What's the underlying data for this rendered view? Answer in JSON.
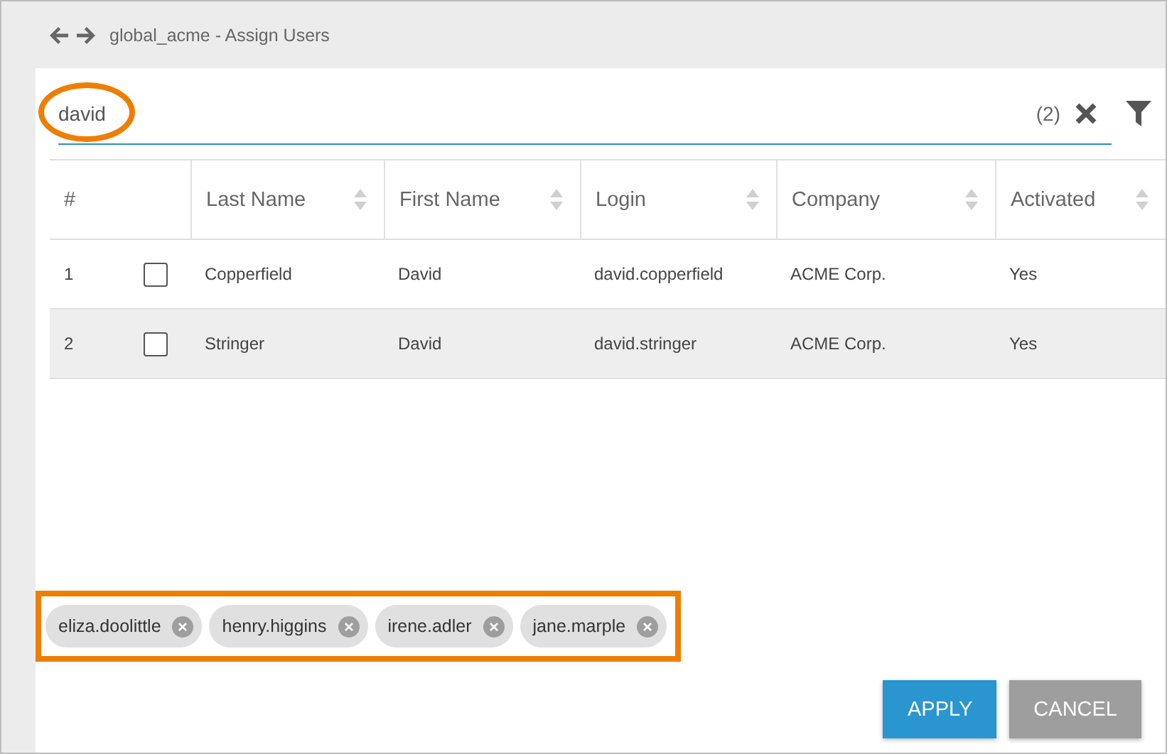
{
  "window": {
    "title": "global_acme - Assign Users"
  },
  "search": {
    "value": "david",
    "count": "(2)"
  },
  "table": {
    "index_header": "#",
    "columns": [
      {
        "label": "Last Name",
        "sortable": true
      },
      {
        "label": "First Name",
        "sortable": true
      },
      {
        "label": "Login",
        "sortable": true
      },
      {
        "label": "Company",
        "sortable": true
      },
      {
        "label": "Activated",
        "sortable": true
      }
    ],
    "rows": [
      {
        "index": "1",
        "checked": false,
        "highlighted": false,
        "cells": [
          "Copperfield",
          "David",
          "david.copperfield",
          "ACME Corp.",
          "Yes"
        ]
      },
      {
        "index": "2",
        "checked": false,
        "highlighted": true,
        "cells": [
          "Stringer",
          "David",
          "david.stringer",
          "ACME Corp.",
          "Yes"
        ]
      }
    ]
  },
  "chips": [
    "eliza.doolittle",
    "henry.higgins",
    "irene.adler",
    "jane.marple"
  ],
  "buttons": [
    {
      "label": "APPLY",
      "kind": "primary"
    },
    {
      "label": "CANCEL",
      "kind": "secondary"
    }
  ]
}
